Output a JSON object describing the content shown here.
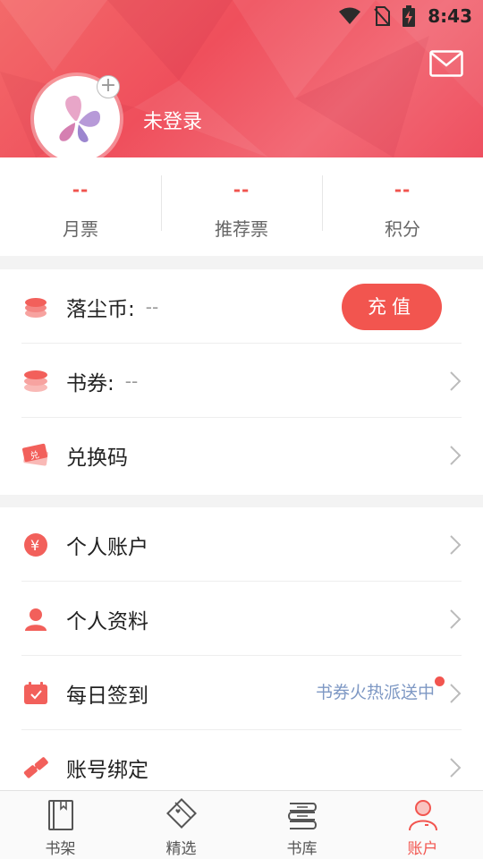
{
  "status_bar": {
    "time": "8:43"
  },
  "header": {
    "user_name": "未登录"
  },
  "stats": [
    {
      "value": "--",
      "label": "月票"
    },
    {
      "value": "--",
      "label": "推荐票"
    },
    {
      "value": "--",
      "label": "积分"
    }
  ],
  "wallet": {
    "coins_label": "落尘币:",
    "coins_value": "--",
    "recharge_label": "充值",
    "vouchers_label": "书券:",
    "vouchers_value": "--",
    "redeem_label": "兑换码"
  },
  "account": {
    "personal_account_label": "个人账户",
    "profile_label": "个人资料",
    "checkin_label": "每日签到",
    "checkin_promo": "书券火热派送中",
    "binding_label": "账号绑定"
  },
  "tabs": [
    {
      "label": "书架",
      "icon": "bookshelf-icon"
    },
    {
      "label": "精选",
      "icon": "featured-icon"
    },
    {
      "label": "书库",
      "icon": "library-icon"
    },
    {
      "label": "账户",
      "icon": "account-icon",
      "active": true
    }
  ],
  "colors": {
    "accent": "#f2554f",
    "promo": "#7e98c4"
  }
}
